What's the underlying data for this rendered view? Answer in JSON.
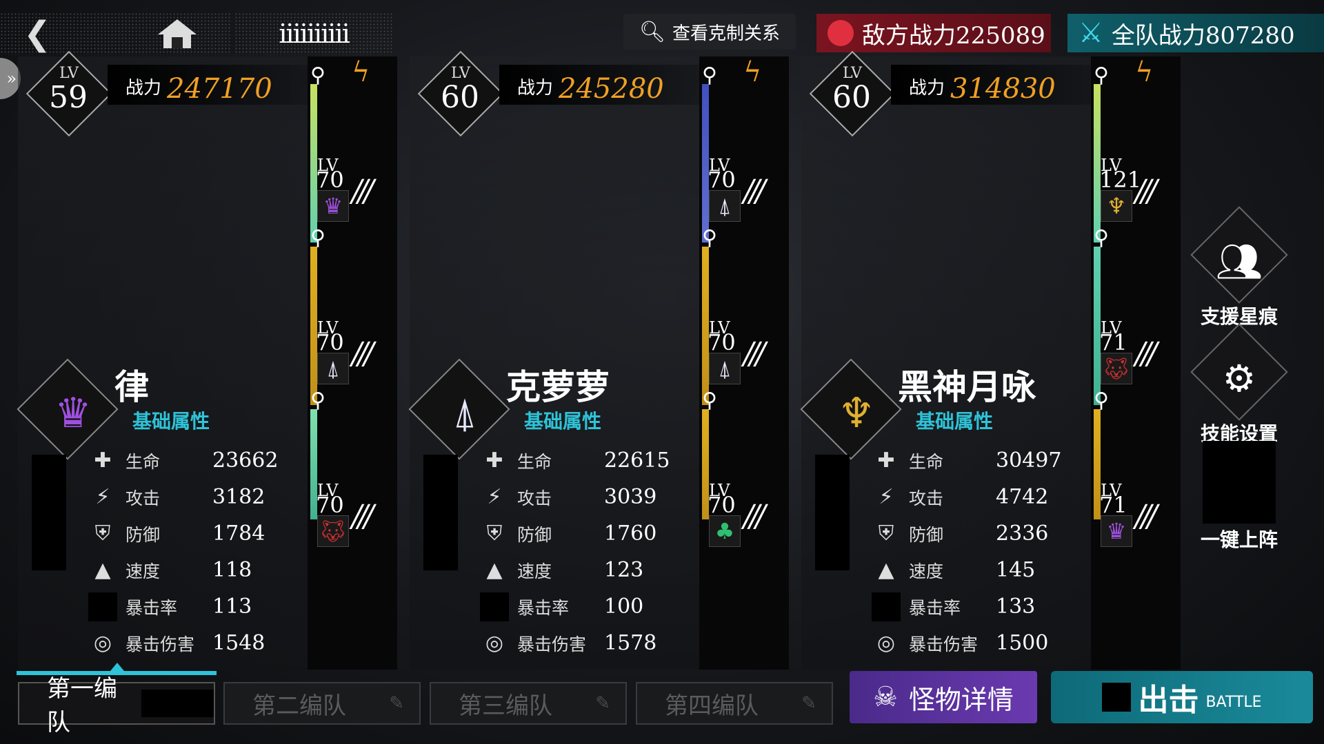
{
  "topbar": {
    "back_icon": "back-arrow-icon",
    "home_icon": "home-icon",
    "menu_text": "iiiiiiiiii",
    "search_label": "查看克制关系",
    "enemy_power_label": "敌方战力225089",
    "team_power_label": "全队战力807280",
    "enemy_color": "#7a1420",
    "team_color": "#0f5f6a"
  },
  "characters": [
    {
      "lv_label": "LV",
      "level": "59",
      "power_label": "战力",
      "power": "247170",
      "name": "律",
      "attr_title": "基础属性",
      "stats": [
        {
          "label": "生命",
          "value": "23662"
        },
        {
          "label": "攻击",
          "value": "3182"
        },
        {
          "label": "防御",
          "value": "1784"
        },
        {
          "label": "速度",
          "value": "118"
        },
        {
          "label": "暴击率",
          "value": "113"
        },
        {
          "label": "暴击伤害",
          "value": "1548"
        }
      ],
      "slots": [
        {
          "lv_label": "LV",
          "level": "70",
          "icon": "purple-crown-icon"
        },
        {
          "lv_label": "LV",
          "level": "70",
          "icon": "angel-wings-icon"
        },
        {
          "lv_label": "LV",
          "level": "70",
          "icon": "red-wolf-icon"
        }
      ]
    },
    {
      "lv_label": "LV",
      "level": "60",
      "power_label": "战力",
      "power": "245280",
      "name": "克萝萝",
      "attr_title": "基础属性",
      "stats": [
        {
          "label": "生命",
          "value": "22615"
        },
        {
          "label": "攻击",
          "value": "3039"
        },
        {
          "label": "防御",
          "value": "1760"
        },
        {
          "label": "速度",
          "value": "123"
        },
        {
          "label": "暴击率",
          "value": "100"
        },
        {
          "label": "暴击伤害",
          "value": "1578"
        }
      ],
      "slots": [
        {
          "lv_label": "LV",
          "level": "70",
          "icon": "angel-wings-icon"
        },
        {
          "lv_label": "LV",
          "level": "70",
          "icon": "angel-wings-icon"
        },
        {
          "lv_label": "LV",
          "level": "70",
          "icon": "green-tree-icon"
        }
      ]
    },
    {
      "lv_label": "LV",
      "level": "60",
      "power_label": "战力",
      "power": "314830",
      "name": "黑神月咏",
      "attr_title": "基础属性",
      "stats": [
        {
          "label": "生命",
          "value": "30497"
        },
        {
          "label": "攻击",
          "value": "4742"
        },
        {
          "label": "防御",
          "value": "2336"
        },
        {
          "label": "速度",
          "value": "145"
        },
        {
          "label": "暴击率",
          "value": "133"
        },
        {
          "label": "暴击伤害",
          "value": "1500"
        }
      ],
      "slots": [
        {
          "lv_label": "LV",
          "level": "121",
          "icon": "gold-chalice-icon"
        },
        {
          "lv_label": "LV",
          "level": "71",
          "icon": "red-wolf-icon"
        },
        {
          "lv_label": "LV",
          "level": "71",
          "icon": "purple-crown-icon"
        }
      ]
    }
  ],
  "right_panel": {
    "support_label": "支援星痕",
    "skill_label": "技能设置",
    "auto_label": "一键上阵"
  },
  "tabs": [
    {
      "label": "第一编队",
      "active": true
    },
    {
      "label": "第二编队",
      "active": false
    },
    {
      "label": "第三编队",
      "active": false
    },
    {
      "label": "第四编队",
      "active": false
    }
  ],
  "buttons": {
    "monster_label": "怪物详情",
    "battle_label": "出击",
    "battle_sub": "BATTLE"
  }
}
